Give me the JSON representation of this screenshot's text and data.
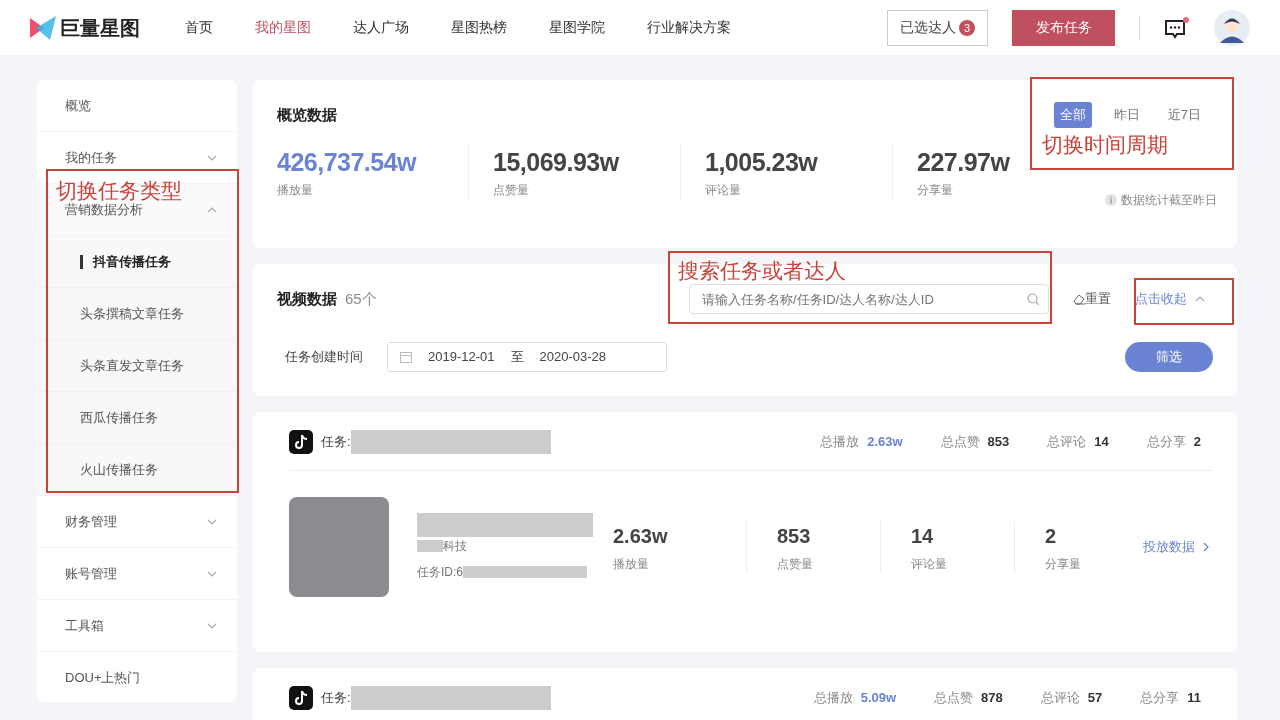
{
  "header": {
    "logo": "巨量星图",
    "nav": [
      {
        "label": "首页",
        "selected": false
      },
      {
        "label": "我的星图",
        "selected": true
      },
      {
        "label": "达人广场",
        "selected": false
      },
      {
        "label": "星图热榜",
        "selected": false
      },
      {
        "label": "星图学院",
        "selected": false
      },
      {
        "label": "行业解决方案",
        "selected": false
      }
    ],
    "selected_talents": {
      "label": "已选达人",
      "count": "3"
    },
    "publish_button": "发布任务",
    "message_unread": true
  },
  "sidebar": {
    "items": [
      {
        "label": "概览",
        "kind": "link"
      },
      {
        "label": "我的任务",
        "kind": "group",
        "expanded": false
      },
      {
        "label": "营销数据分析",
        "kind": "group",
        "expanded": true,
        "children": [
          {
            "label": "抖音传播任务",
            "selected": true
          },
          {
            "label": "头条撰稿文章任务",
            "selected": false
          },
          {
            "label": "头条直发文章任务",
            "selected": false
          },
          {
            "label": "西瓜传播任务",
            "selected": false
          },
          {
            "label": "火山传播任务",
            "selected": false
          }
        ]
      },
      {
        "label": "财务管理",
        "kind": "group",
        "expanded": false
      },
      {
        "label": "账号管理",
        "kind": "group",
        "expanded": false
      },
      {
        "label": "工具箱",
        "kind": "group",
        "expanded": false
      },
      {
        "label": "DOU+上热门",
        "kind": "link"
      }
    ]
  },
  "overview": {
    "title": "概览数据",
    "periods": [
      {
        "label": "全部",
        "selected": true
      },
      {
        "label": "昨日",
        "selected": false
      },
      {
        "label": "近7日",
        "selected": false
      }
    ],
    "stats": [
      {
        "value": "426,737.54w",
        "label": "播放量",
        "highlight": true
      },
      {
        "value": "15,069.93w",
        "label": "点赞量",
        "highlight": false
      },
      {
        "value": "1,005.23w",
        "label": "评论量",
        "highlight": false
      },
      {
        "value": "227.97w",
        "label": "分享量",
        "highlight": false
      }
    ],
    "note": "数据统计截至昨日"
  },
  "video_data": {
    "title": "视频数据",
    "count": "65个",
    "search": {
      "placeholder": "请输入任务名称/任务ID/达人名称/达人ID"
    },
    "reset": "重置",
    "collapse": "点击收起",
    "filter_label": "任务创建时间",
    "date_start": "2019-12-01",
    "date_sep": "至",
    "date_end": "2020-03-28",
    "filter_button": "筛选"
  },
  "tasks": [
    {
      "label": "任务:",
      "totals": [
        {
          "label": "总播放",
          "value": "2.63w",
          "highlight": true
        },
        {
          "label": "总点赞",
          "value": "853",
          "highlight": false
        },
        {
          "label": "总评论",
          "value": "14",
          "highlight": false
        },
        {
          "label": "总分享",
          "value": "2",
          "highlight": false
        }
      ],
      "video": {
        "company": "科技",
        "id_label": "任务ID:6",
        "stats": [
          {
            "value": "2.63w",
            "label": "播放量"
          },
          {
            "value": "853",
            "label": "点赞量"
          },
          {
            "value": "14",
            "label": "评论量"
          },
          {
            "value": "2",
            "label": "分享量"
          }
        ],
        "link": "投放数据"
      }
    },
    {
      "label": "任务:",
      "totals": [
        {
          "label": "总播放",
          "value": "5.09w",
          "highlight": true
        },
        {
          "label": "总点赞",
          "value": "878",
          "highlight": false
        },
        {
          "label": "总评论",
          "value": "57",
          "highlight": false
        },
        {
          "label": "总分享",
          "value": "11",
          "highlight": false
        }
      ]
    }
  ],
  "annotations": [
    {
      "kind": "labeled",
      "text": "切换任务类型"
    },
    {
      "kind": "labeled",
      "text": "切换时间周期"
    },
    {
      "kind": "labeled",
      "text": "搜索任务或者达人"
    },
    {
      "kind": "box"
    }
  ]
}
